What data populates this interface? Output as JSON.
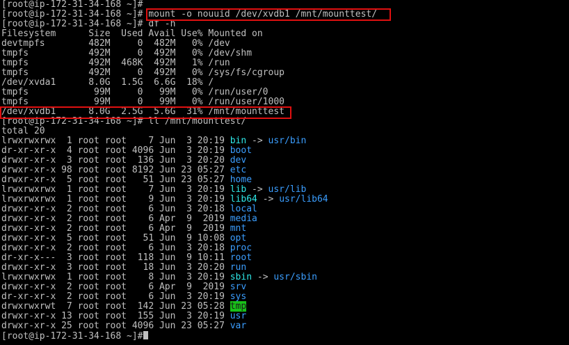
{
  "colors": {
    "background": "#000000",
    "foreground": "#c0c0c0",
    "directory": "#3b9eff",
    "symlink": "#2ee8e8",
    "sticky_dir_bg": "#18c018",
    "highlight_box": "#e01010"
  },
  "prompt": "[root@ip-172-31-34-168 ~]#",
  "top_line": "[root@ip-172-31-34-168 ~]#",
  "cmd1": {
    "prompt": "[root@ip-172-31-34-168 ~]#",
    "command": " mount -o nouuid /dev/xvdb1 /mnt/mounttest/"
  },
  "cmd2": {
    "prompt": "[root@ip-172-31-34-168 ~]#",
    "command": " df -h"
  },
  "df": {
    "header": "Filesystem      Size  Used Avail Use% Mounted on",
    "rows": [
      "devtmpfs        482M     0  482M   0% /dev",
      "tmpfs           492M     0  492M   0% /dev/shm",
      "tmpfs           492M  468K  492M   1% /run",
      "tmpfs           492M     0  492M   0% /sys/fs/cgroup",
      "/dev/xvda1      8.0G  1.5G  6.6G  18% /",
      "tmpfs            99M     0   99M   0% /run/user/0",
      "tmpfs            99M     0   99M   0% /run/user/1000",
      "/dev/xvdb1      8.0G  2.5G  5.6G  31% /mnt/mounttest"
    ]
  },
  "cmd3": {
    "prompt": "[root@ip-172-31-34-168 ~]#",
    "command": " ll /mnt/mounttest/"
  },
  "total": "total 20",
  "ls": [
    {
      "meta": "lrwxrwxrwx  1 root root    7 Jun  3 20:19 ",
      "name": "bin",
      "arrow": " -> ",
      "target": "usr/bin"
    },
    {
      "meta": "dr-xr-xr-x  4 root root 4096 Jun  3 20:19 ",
      "name": "boot"
    },
    {
      "meta": "drwxr-xr-x  3 root root  136 Jun  3 20:20 ",
      "name": "dev"
    },
    {
      "meta": "drwxr-xr-x 98 root root 8192 Jun 23 05:27 ",
      "name": "etc"
    },
    {
      "meta": "drwxr-xr-x  5 root root   51 Jun 23 05:27 ",
      "name": "home"
    },
    {
      "meta": "lrwxrwxrwx  1 root root    7 Jun  3 20:19 ",
      "name": "lib",
      "arrow": " -> ",
      "target": "usr/lib"
    },
    {
      "meta": "lrwxrwxrwx  1 root root    9 Jun  3 20:19 ",
      "name": "lib64",
      "arrow": " -> ",
      "target": "usr/lib64"
    },
    {
      "meta": "drwxr-xr-x  2 root root    6 Jun  3 20:18 ",
      "name": "local"
    },
    {
      "meta": "drwxr-xr-x  2 root root    6 Apr  9  2019 ",
      "name": "media"
    },
    {
      "meta": "drwxr-xr-x  2 root root    6 Apr  9  2019 ",
      "name": "mnt"
    },
    {
      "meta": "drwxr-xr-x  5 root root   51 Jun  9 10:08 ",
      "name": "opt"
    },
    {
      "meta": "drwxr-xr-x  2 root root    6 Jun  3 20:18 ",
      "name": "proc"
    },
    {
      "meta": "dr-xr-x---  3 root root  118 Jun  9 10:11 ",
      "name": "root"
    },
    {
      "meta": "drwxr-xr-x  3 root root   18 Jun  3 20:20 ",
      "name": "run"
    },
    {
      "meta": "lrwxrwxrwx  1 root root    8 Jun  3 20:19 ",
      "name": "sbin",
      "arrow": " -> ",
      "target": "usr/sbin"
    },
    {
      "meta": "drwxr-xr-x  2 root root    6 Apr  9  2019 ",
      "name": "srv"
    },
    {
      "meta": "dr-xr-xr-x  2 root root    6 Jun  3 20:19 ",
      "name": "sys"
    },
    {
      "meta": "drwxrwxrwt  7 root root  142 Jun 23 05:28 ",
      "name": "tmp"
    },
    {
      "meta": "drwxr-xr-x 13 root root  155 Jun  3 20:19 ",
      "name": "usr"
    },
    {
      "meta": "drwxr-xr-x 25 root root 4096 Jun 23 05:27 ",
      "name": "var"
    }
  ],
  "final_prompt": "[root@ip-172-31-34-168 ~]#"
}
